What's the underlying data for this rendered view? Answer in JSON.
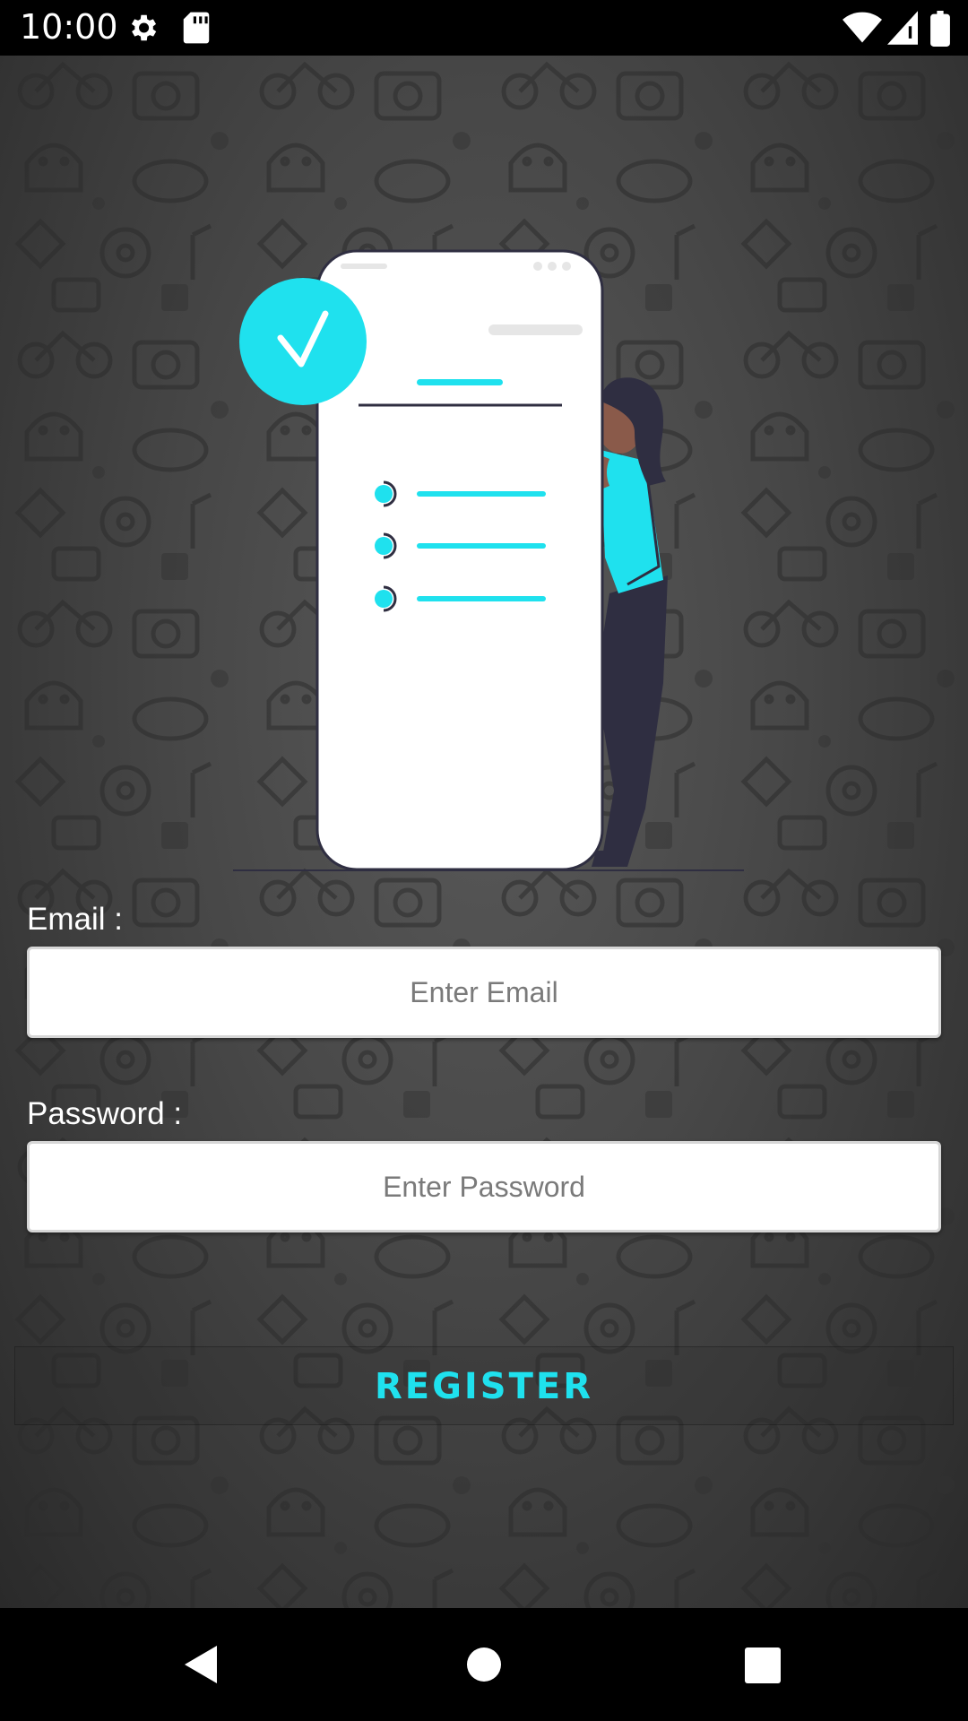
{
  "status_bar": {
    "time": "10:00",
    "icons": [
      "gear-icon",
      "sd-card-icon",
      "wifi-icon",
      "cell-signal-icon",
      "battery-icon"
    ]
  },
  "form": {
    "email_label": "Email :",
    "email_placeholder": "Enter Email",
    "email_value": "",
    "password_label": "Password :",
    "password_placeholder": "Enter Password",
    "password_value": "",
    "register_label": "REGISTER"
  },
  "colors": {
    "accent": "#1FE1EE",
    "figure_dark": "#2F2E41",
    "background": "#474747"
  },
  "nav_bar": {
    "icons": [
      "back-icon",
      "home-icon",
      "recents-icon"
    ]
  }
}
